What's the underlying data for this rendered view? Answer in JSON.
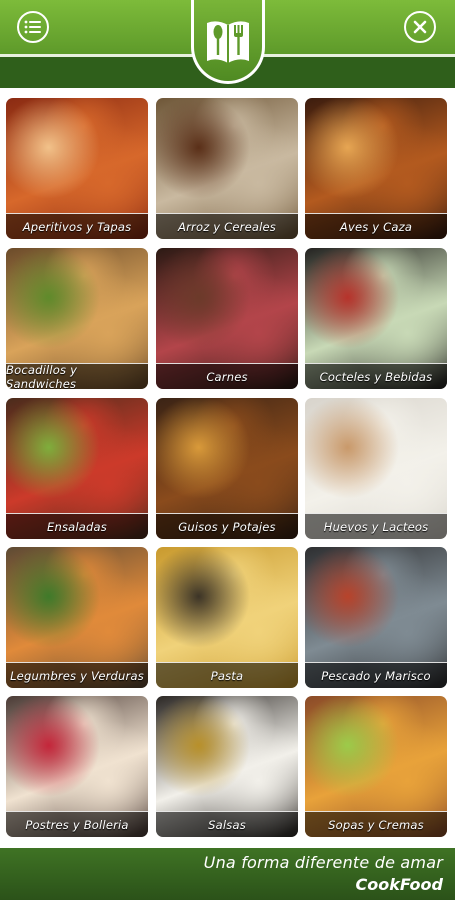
{
  "header": {
    "menu_icon": "menu-lines-icon",
    "logo_icon": "book-spoon-fork-icon",
    "close_icon": "close-x-icon"
  },
  "categories": [
    {
      "label": "Aperitivos y Tapas",
      "icon": "tapas-image",
      "colors": [
        "#8a2a12",
        "#d7682b",
        "#f2c28a"
      ]
    },
    {
      "label": "Arroz y Cereales",
      "icon": "rice-grains-image",
      "colors": [
        "#6e5637",
        "#c9b9a0",
        "#5a2f18"
      ]
    },
    {
      "label": "Aves y Caza",
      "icon": "roast-poultry-image",
      "colors": [
        "#3b1c0e",
        "#b35a1f",
        "#e7a653"
      ]
    },
    {
      "label": "Bocadillos y Sandwiches",
      "icon": "sandwich-image",
      "colors": [
        "#6b4b2a",
        "#d9a35a",
        "#5f8b2b"
      ]
    },
    {
      "label": "Carnes",
      "icon": "steak-image",
      "colors": [
        "#2b1a14",
        "#b3454a",
        "#6c3a2a"
      ]
    },
    {
      "label": "Cocteles y Bebidas",
      "icon": "cocktails-image",
      "colors": [
        "#232220",
        "#c8d9b6",
        "#b7332b"
      ]
    },
    {
      "label": "Ensaladas",
      "icon": "salad-bowl-image",
      "colors": [
        "#4a2c1c",
        "#cc3a2a",
        "#7fae3c"
      ]
    },
    {
      "label": "Guisos y Potajes",
      "icon": "stew-pot-image",
      "colors": [
        "#3a2315",
        "#8a4b1c",
        "#d99a3a"
      ]
    },
    {
      "label": "Huevos y Lacteos",
      "icon": "eggs-milk-image",
      "colors": [
        "#d8d4cc",
        "#f3f1ea",
        "#c9996a"
      ]
    },
    {
      "label": "Legumbres y Verduras",
      "icon": "legumes-image",
      "colors": [
        "#5d4a34",
        "#e08a3a",
        "#3f7a2a"
      ]
    },
    {
      "label": "Pasta",
      "icon": "pasta-image",
      "colors": [
        "#c99a2e",
        "#f0d27a",
        "#3c3427"
      ]
    },
    {
      "label": "Pescado y Marisco",
      "icon": "seafood-image",
      "colors": [
        "#2e2f31",
        "#7f8b93",
        "#b8432b"
      ]
    },
    {
      "label": "Postres y Bolleria",
      "icon": "desserts-image",
      "colors": [
        "#4a3a35",
        "#f0e2d0",
        "#c4263a"
      ]
    },
    {
      "label": "Salsas",
      "icon": "sauces-image",
      "colors": [
        "#2b2724",
        "#f2f0ea",
        "#b8902a"
      ]
    },
    {
      "label": "Sopas y Cremas",
      "icon": "soups-image",
      "colors": [
        "#8a4a28",
        "#e8a23a",
        "#9ccb4a"
      ]
    }
  ],
  "footer": {
    "tagline": "Una forma diferente de amar",
    "brand": "CookFood"
  }
}
